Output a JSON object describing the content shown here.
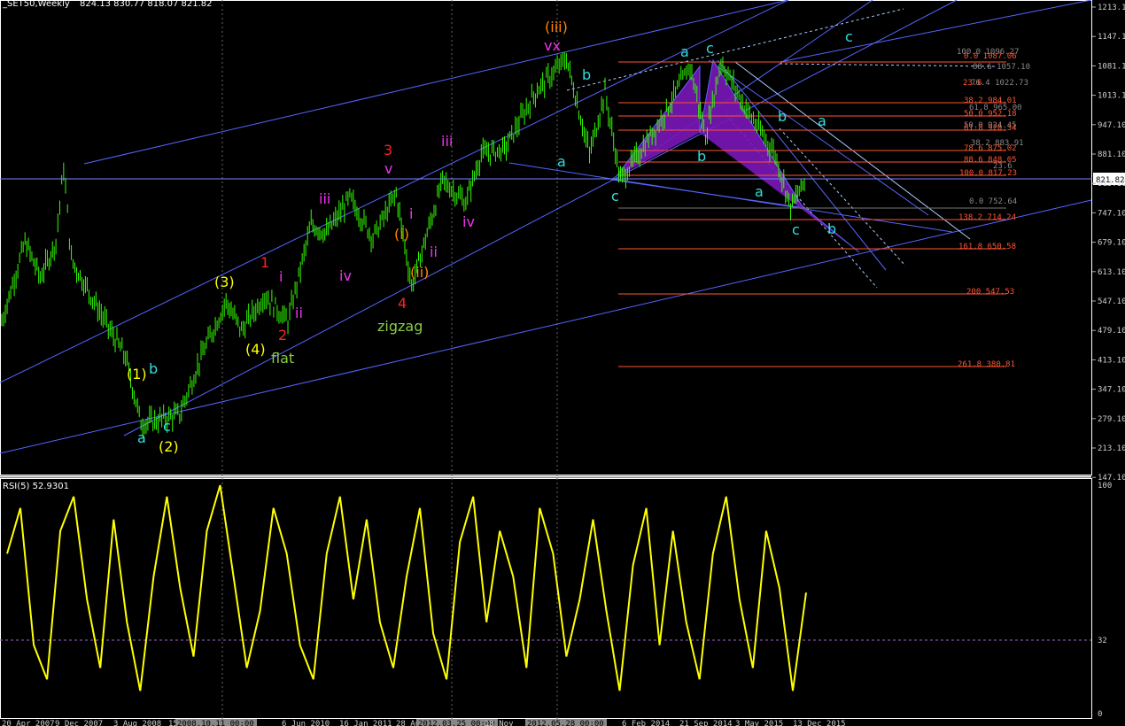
{
  "header": {
    "symbol": "_SET50,Weekly",
    "ohlc": "824.13 830.77 818.07 821.82"
  },
  "price_axis": {
    "ticks": [
      "1213.10",
      "1147.10",
      "1081.10",
      "1013.10",
      "947.10",
      "881.10",
      "813.10",
      "747.10",
      "679.10",
      "613.10",
      "547.10",
      "479.10",
      "413.10",
      "347.10",
      "279.10",
      "213.10",
      "147.10"
    ],
    "current": "821.82"
  },
  "rsi": {
    "label": "RSI(5) 52.9301",
    "ticks": [
      "100",
      "32",
      "0"
    ],
    "level": 32
  },
  "time_axis": [
    "20 Apr 2007",
    "9 Dec 2007",
    "3 Aug 2008",
    "15 Mar",
    "2008.10.11 00:00",
    "6 Jun 2010",
    "16 Jan 2011",
    "28 Aug",
    "2012.03.25 00:00",
    "18 Nov",
    "2012.05.28 00:00",
    "6 Feb 2014",
    "21 Sep 2014",
    "3 May 2015",
    "13 Dec 2015"
  ],
  "colors": {
    "candles": "#33ff00",
    "channel": "#5566ff",
    "fib": "#ff5533",
    "rsi": "#ffff00",
    "pattern": "#7a16b8",
    "cyan": "#33dddd"
  },
  "fibs": [
    {
      "text": "0.0 1087.06",
      "color": "#ff5533"
    },
    {
      "text": "100.0 1096.27",
      "color": "#888888"
    },
    {
      "text": "88.6 1057.10",
      "color": "#888888"
    },
    {
      "text": "23.6",
      "color": "#ff5533"
    },
    {
      "text": "76.4 1022.73",
      "color": "#888888"
    },
    {
      "text": "38.2 984.01",
      "color": "#ff5533"
    },
    {
      "text": "61.8 965.00",
      "color": "#888888"
    },
    {
      "text": "50.0 952.18",
      "color": "#ff5533"
    },
    {
      "text": "50.0 924.45",
      "color": "#888888"
    },
    {
      "text": "61.8 920.34",
      "color": "#ff5533"
    },
    {
      "text": "38.2 883.91",
      "color": "#888888"
    },
    {
      "text": "78.6 875.02",
      "color": "#ff5533"
    },
    {
      "text": "88.6 848.05",
      "color": "#ff5533"
    },
    {
      "text": "23.6",
      "color": "#888888"
    },
    {
      "text": "100.0 817.23",
      "color": "#ff5533"
    },
    {
      "text": "0.0 752.64",
      "color": "#888888"
    },
    {
      "text": "138.2 714.24",
      "color": "#ff5533"
    },
    {
      "text": "161.8 650.58",
      "color": "#ff5533"
    },
    {
      "text": "200 547.53",
      "color": "#ff5533"
    },
    {
      "text": "261.8 380.81",
      "color": "#ff5533"
    }
  ],
  "wave_labels": [
    {
      "text": "(1)",
      "color": "#ffff00"
    },
    {
      "text": "b",
      "color": "#33dddd"
    },
    {
      "text": "a",
      "color": "#33dddd"
    },
    {
      "text": "c",
      "color": "#33dddd"
    },
    {
      "text": "(2)",
      "color": "#ffff00"
    },
    {
      "text": "(3)",
      "color": "#ffff00"
    },
    {
      "text": "(4)",
      "color": "#ffff00"
    },
    {
      "text": "flat",
      "color": "#88cc44"
    },
    {
      "text": "1",
      "color": "#ff2222"
    },
    {
      "text": "2",
      "color": "#ff2222"
    },
    {
      "text": "i",
      "color": "#ee33ee"
    },
    {
      "text": "ii",
      "color": "#ee33ee"
    },
    {
      "text": "iii",
      "color": "#ee33ee"
    },
    {
      "text": "iv",
      "color": "#ee33ee"
    },
    {
      "text": "3",
      "color": "#ff2222"
    },
    {
      "text": "v",
      "color": "#ee33ee"
    },
    {
      "text": "(i)",
      "color": "#ff8800"
    },
    {
      "text": "(ii)",
      "color": "#ff8800"
    },
    {
      "text": "4",
      "color": "#ff2222"
    },
    {
      "text": "zigzag",
      "color": "#88cc44"
    },
    {
      "text": "i",
      "color": "#ee33ee"
    },
    {
      "text": "ii",
      "color": "#ee33ee"
    },
    {
      "text": "iii",
      "color": "#ee33ee"
    },
    {
      "text": "iv",
      "color": "#ee33ee"
    },
    {
      "text": "(iii)",
      "color": "#ff8800"
    },
    {
      "text": "vx",
      "color": "#ee33ee"
    },
    {
      "text": "a",
      "color": "#33dddd"
    },
    {
      "text": "b",
      "color": "#33dddd"
    },
    {
      "text": "c",
      "color": "#33dddd"
    },
    {
      "text": "a",
      "color": "#33dddd"
    },
    {
      "text": "c",
      "color": "#33dddd"
    },
    {
      "text": "b",
      "color": "#33dddd"
    },
    {
      "text": "b",
      "color": "#33dddd"
    },
    {
      "text": "a",
      "color": "#33dddd"
    },
    {
      "text": "a",
      "color": "#33dddd"
    },
    {
      "text": "c",
      "color": "#33dddd"
    },
    {
      "text": "b",
      "color": "#33dddd"
    },
    {
      "text": "c",
      "color": "#33dddd"
    }
  ],
  "chart_data": {
    "type": "candlestick",
    "title": "_SET50,Weekly",
    "ylim": [
      147.1,
      1213.1
    ],
    "price_path": [
      [
        "2007-04",
        500
      ],
      [
        "2007-07",
        680
      ],
      [
        "2007-09",
        600
      ],
      [
        "2007-11",
        680
      ],
      [
        "2007-12",
        850
      ],
      [
        "2008-01",
        640
      ],
      [
        "2008-06",
        480
      ],
      [
        "2008-08",
        420
      ],
      [
        "2008-10",
        270
      ],
      [
        "2008-12",
        275
      ],
      [
        "2009-03",
        290
      ],
      [
        "2009-06",
        430
      ],
      [
        "2009-09",
        545
      ],
      [
        "2009-11",
        480
      ],
      [
        "2010-02",
        560
      ],
      [
        "2010-05",
        500
      ],
      [
        "2010-08",
        720
      ],
      [
        "2010-10",
        700
      ],
      [
        "2011-01",
        780
      ],
      [
        "2011-04",
        690
      ],
      [
        "2011-07",
        790
      ],
      [
        "2011-09",
        580
      ],
      [
        "2011-11",
        700
      ],
      [
        "2012-01",
        820
      ],
      [
        "2012-04",
        770
      ],
      [
        "2012-06",
        880
      ],
      [
        "2012-09",
        890
      ],
      [
        "2013-01",
        1020
      ],
      [
        "2013-05",
        1096
      ],
      [
        "2013-08",
        880
      ],
      [
        "2013-10",
        1020
      ],
      [
        "2013-12",
        820
      ],
      [
        "2014-05",
        950
      ],
      [
        "2014-09",
        1080
      ],
      [
        "2014-11",
        920
      ],
      [
        "2015-01",
        1090
      ],
      [
        "2015-04",
        990
      ],
      [
        "2015-08",
        880
      ],
      [
        "2015-10",
        760
      ],
      [
        "2015-12",
        822
      ]
    ],
    "rsi_series": {
      "name": "RSI(5)",
      "last": 52.9301,
      "ylim": [
        0,
        100
      ],
      "values": [
        70,
        90,
        30,
        15,
        80,
        95,
        50,
        20,
        85,
        40,
        10,
        60,
        95,
        55,
        25,
        80,
        100,
        60,
        20,
        45,
        90,
        70,
        30,
        15,
        70,
        95,
        50,
        85,
        40,
        20,
        60,
        90,
        35,
        15,
        75,
        95,
        40,
        80,
        60,
        20,
        90,
        70,
        25,
        50,
        85,
        45,
        10,
        65,
        90,
        30,
        80,
        40,
        15,
        70,
        95,
        50,
        20,
        80,
        55,
        10,
        52.93
      ]
    },
    "fib_levels": [
      1087.06,
      1057.1,
      1022.73,
      984.01,
      965.0,
      952.18,
      924.45,
      920.34,
      883.91,
      875.02,
      848.05,
      817.23,
      752.64,
      714.24,
      650.58,
      547.53,
      380.81
    ]
  }
}
